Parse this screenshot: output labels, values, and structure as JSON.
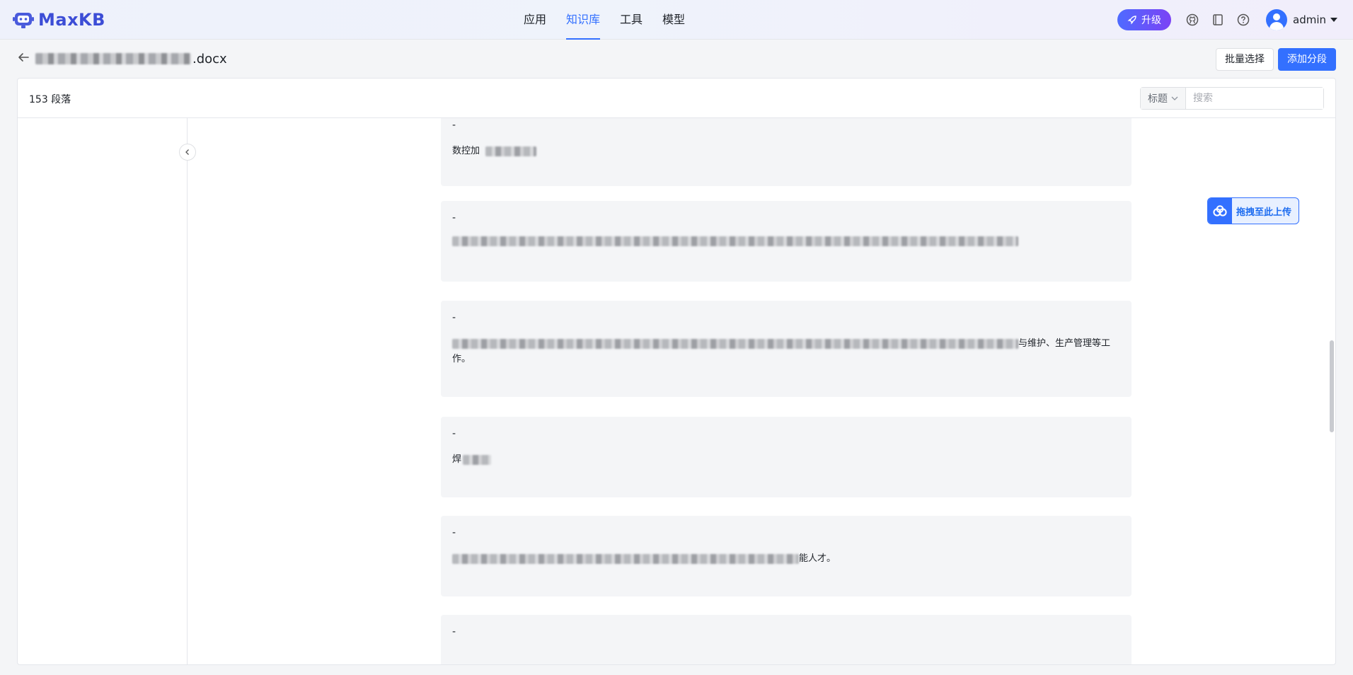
{
  "app": {
    "logo_text": "MaxKB",
    "nav": [
      {
        "label": "应用",
        "active": false
      },
      {
        "label": "知识库",
        "active": true
      },
      {
        "label": "工具",
        "active": false
      },
      {
        "label": "模型",
        "active": false
      }
    ],
    "upgrade_label": "升级",
    "user_name": "admin",
    "icons": [
      "rocket-icon",
      "github-icon",
      "book-icon",
      "help-icon",
      "user-avatar",
      "caret-down-icon"
    ]
  },
  "doc": {
    "title_suffix": ".docx",
    "batch_select_label": "批量选择",
    "add_segment_label": "添加分段"
  },
  "panel": {
    "count_label": "153 段落",
    "search_select_value": "标题",
    "search_placeholder": "搜索"
  },
  "segments": [
    {
      "dash": "-",
      "text_visible": "数控加"
    },
    {
      "dash": "-",
      "text_visible": ""
    },
    {
      "dash": "-",
      "text_visible": "与维护、生产管理等工",
      "text_line2": "作。"
    },
    {
      "dash": "-",
      "text_visible": "焊"
    },
    {
      "dash": "-",
      "text_visible": "能人才。"
    },
    {
      "dash": "-",
      "text_visible": ""
    }
  ],
  "upload_float": {
    "label": "拖拽至此上传"
  },
  "colors": {
    "primary": "#3370ff",
    "upgrade_start": "#4e6bff",
    "upgrade_end": "#7b42f5",
    "card_bg": "#f4f5f7"
  }
}
